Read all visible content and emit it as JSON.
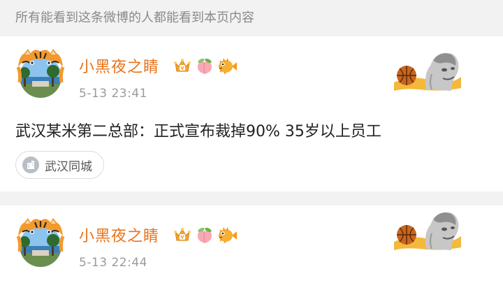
{
  "banner": {
    "text": "所有能看到这条微博的人都能看到本页内容"
  },
  "posts": [
    {
      "username": "小黑夜之睛",
      "timestamp": "5-13 23:41",
      "text": "武汉某米第二总部：正式宣布裁掉90% 35岁以上员工",
      "location": "武汉同城",
      "badges": [
        "crown-badge-icon",
        "peach-icon",
        "pufferfish-icon"
      ]
    },
    {
      "username": "小黑夜之睛",
      "timestamp": "5-13 22:44",
      "badges": [
        "crown-badge-icon",
        "peach-icon",
        "pufferfish-icon"
      ]
    }
  ],
  "colors": {
    "username": "#e8731a",
    "timestamp": "#9b9b9b",
    "banner_text": "#8a8a8a",
    "background": "#f2f2f2"
  }
}
